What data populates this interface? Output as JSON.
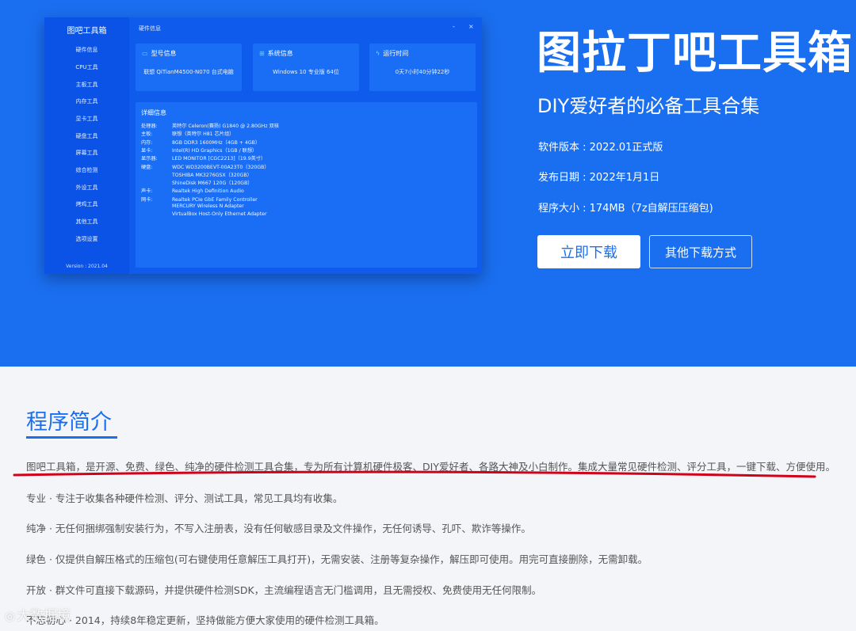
{
  "app_window": {
    "logo": "图吧工具箱",
    "nav": [
      "硬件信息",
      "CPU工具",
      "主板工具",
      "内存工具",
      "显卡工具",
      "硬盘工具",
      "屏幕工具",
      "综合检测",
      "外设工具",
      "烤鸡工具",
      "其他工具",
      "选项设置"
    ],
    "version": "Version : 2021.04",
    "titlebar": {
      "title": "硬件信息",
      "minimize": "-",
      "close": "×"
    },
    "cards": [
      {
        "title": "型号信息",
        "icon": "monitor-icon",
        "value": "联想 QiTianM4500-N070 台式电脑"
      },
      {
        "title": "系统信息",
        "icon": "windows-icon",
        "value": "Windows 10 专业版 64位"
      },
      {
        "title": "运行时间",
        "icon": "lightning-icon",
        "value": "0天7小时40分钟22秒"
      }
    ],
    "detail": {
      "title": "详细信息",
      "rows": [
        {
          "key": "处理器:",
          "value": "英特尔 Celeron(赛扬) G1840 @ 2.80GHz 双核"
        },
        {
          "key": "主板:",
          "value": "联想（英特尔 H81 芯片组）"
        },
        {
          "key": "内存:",
          "value": "8GB DDR3 1600MHz（4GB + 4GB）"
        },
        {
          "key": "显卡:",
          "value": "Intel(R) HD Graphics（1GB / 联想）"
        },
        {
          "key": "显示器:",
          "value": "LED MONITOR [CGC2213]（19.9英寸）"
        },
        {
          "key": "硬盘:",
          "value": "WDC WD3200BEVT-00A23T0（320GB）"
        },
        {
          "key": "",
          "value": "TOSHIBA MK3276GSX（320GB）"
        },
        {
          "key": "",
          "value": "ShineDisk M667 120G（120GB）"
        },
        {
          "key": "声卡:",
          "value": "Realtek High Definition Audio"
        },
        {
          "key": "网卡:",
          "value": "Realtek PCIe GbE Family Controller"
        },
        {
          "key": "",
          "value": "MERCURY Wireless N Adapter"
        },
        {
          "key": "",
          "value": "VirtualBox Host-Only Ethernet Adapter"
        }
      ]
    }
  },
  "hero": {
    "title": "图拉丁吧工具箱",
    "subtitle": "DIY爱好者的必备工具合集",
    "meta": [
      "软件版本 : 2022.01正式版",
      "发布日期 : 2022年1月1日",
      "程序大小 : 174MB（7z自解压压缩包)"
    ],
    "download_button": "立即下载",
    "other_download_button": "其他下载方式"
  },
  "intro": {
    "title": "程序简介",
    "paragraphs": [
      "图吧工具箱，是开源、免费、绿色、纯净的硬件检测工具合集，专为所有计算机硬件极客、DIY爱好者、各路大神及小白制作。集成大量常见硬件检测、评分工具，一键下载、方便使用。",
      "专业 · 专注于收集各种硬件检测、评分、测试工具，常见工具均有收集。",
      "纯净 · 无任何捆绑强制安装行为，不写入注册表，没有任何敏感目录及文件操作，无任何诱导、孔吓、欺诈等操作。",
      "绿色 · 仅提供自解压格式的压缩包(可右键使用任意解压工具打开)，无需安装、注册等复杂操作，解压即可使用。用完可直接删除，无需卸载。",
      "开放 · 群文件可直接下载源码，并提供硬件检测SDK，主流编程语言无门槛调用，且无需授权、免费使用无任何限制。",
      "不忘初心 · 2014，持续8年稳定更新，坚持做能方便大家使用的硬件检测工具箱。"
    ]
  },
  "watermark": "大数据境",
  "colors": {
    "hero_bg": "#1a6ff0",
    "accent": "#1a6ff0",
    "annotation": "#d0021b"
  }
}
